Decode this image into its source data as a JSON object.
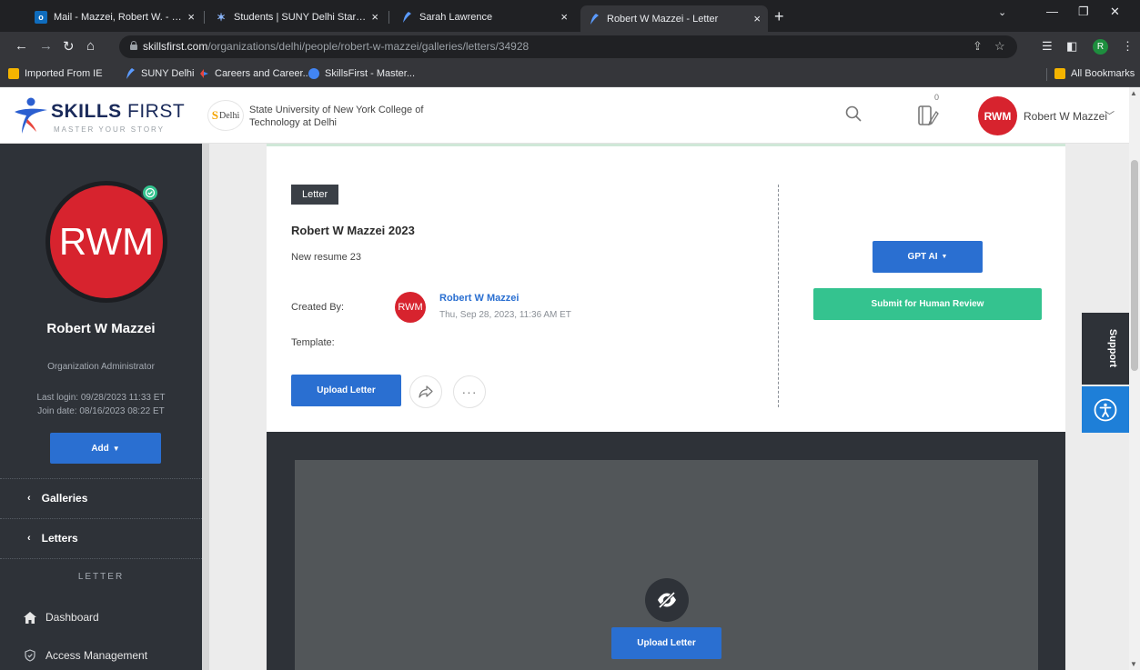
{
  "browser": {
    "tabs": [
      {
        "label": "Mail - Mazzei, Robert W. - Outlo",
        "favicon": "outlook-icon",
        "color": "#0f6cbd"
      },
      {
        "label": "Students | SUNY Delhi Starfish S",
        "favicon": "starfish-icon",
        "color": "#2a6fd1"
      },
      {
        "label": "Sarah Lawrence",
        "favicon": "skillsfirst-icon",
        "color": "#2a6fd1"
      },
      {
        "label": "Robert W Mazzei - Letter",
        "favicon": "skillsfirst-icon",
        "color": "#2a6fd1",
        "active": true
      }
    ],
    "url_host": "skillsfirst.com",
    "url_path": "/organizations/delhi/people/robert-w-mazzei/galleries/letters/34928",
    "profile_initial": "R",
    "bookmarks": [
      {
        "label": "Imported From IE",
        "icon": "folder-icon"
      },
      {
        "label": "SUNY Delhi",
        "icon": "skillsfirst-icon"
      },
      {
        "label": "Careers and Career...",
        "icon": "careers-icon"
      },
      {
        "label": "SkillsFirst - Master...",
        "icon": "skillsfirst-icon"
      }
    ],
    "all_bookmarks": "All Bookmarks"
  },
  "header": {
    "brand_bold": "SKILLS",
    "brand_thin": "FIRST",
    "brand_tagline": "MASTER YOUR STORY",
    "org_logo_text": "Delhi",
    "org_name": "State University of New York College of Technology at Delhi",
    "notif_count": "0",
    "user_initials": "RWM",
    "user_name": "Robert W Mazzei"
  },
  "sidebar": {
    "initials": "RWM",
    "name": "Robert W Mazzei",
    "role": "Organization Administrator",
    "last_login": "Last login: 09/28/2023 11:33 ET",
    "join_date": "Join date: 08/16/2023 08:22 ET",
    "add_label": "Add",
    "nav_galleries": "Galleries",
    "nav_letters": "Letters",
    "section_label": "LETTER",
    "menu_dashboard": "Dashboard",
    "menu_access": "Access Management"
  },
  "card": {
    "badge": "Letter",
    "title": "Robert W Mazzei 2023",
    "subtitle": "New resume 23",
    "created_by_label": "Created By:",
    "creator_initials": "RWM",
    "creator_name": "Robert W Mazzei",
    "created_date": "Thu, Sep 28, 2023, 11:36 AM ET",
    "template_label": "Template:",
    "upload_label": "Upload Letter",
    "gpt_label": "GPT AI",
    "review_label": "Submit for Human Review"
  },
  "preview": {
    "upload_label": "Upload Letter"
  },
  "floating": {
    "support_label": "Support"
  },
  "colors": {
    "brand_blue": "#2a6fd1",
    "accent_green": "#34c38f",
    "avatar_red": "#d7232e",
    "sidebar_dark": "#2e3238"
  }
}
